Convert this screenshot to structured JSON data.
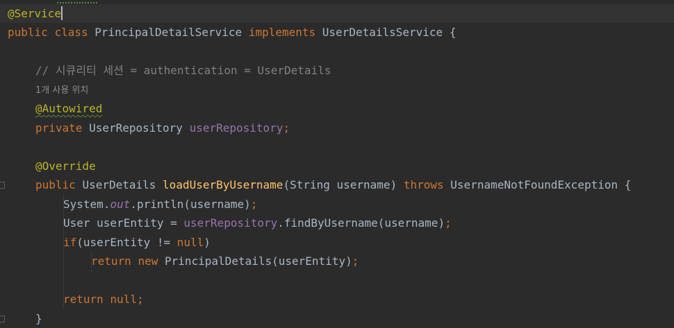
{
  "editor": {
    "lines": {
      "l1": {
        "annotation": "@Service"
      },
      "l2": {
        "kw_public": "public",
        "kw_class": "class",
        "class_name": "PrincipalDetailService",
        "kw_implements": "implements",
        "interface_name": "UserDetailsService",
        "brace": "{"
      },
      "l3": {
        "comment": "// 시큐리티 세션 = authentication = UserDetails"
      },
      "l4": {
        "usage_hint": "1개 사용 위치"
      },
      "l5": {
        "annotation": "@Autowired"
      },
      "l6": {
        "kw_private": "private",
        "type": "UserRepository",
        "field": "userRepository",
        "semicolon": ";"
      },
      "l7": {
        "annotation": "@Override"
      },
      "l8": {
        "kw_public": "public",
        "return_type": "UserDetails",
        "method": "loadUserByUsername",
        "params": "(String username)",
        "kw_throws": "throws",
        "exception": "UsernameNotFoundException",
        "brace": "{"
      },
      "l9": {
        "object": "System.",
        "static_field": "out",
        "call": ".println(username)",
        "semicolon": ";"
      },
      "l10": {
        "decl": "User userEntity = ",
        "field": "userRepository",
        "call": ".findByUsername(username)",
        "semicolon": ";"
      },
      "l11": {
        "kw_if": "if",
        "cond_open": "(userEntity != ",
        "kw_null": "null",
        "cond_close": ")"
      },
      "l12": {
        "kw_return": "return",
        "kw_new": "new",
        "ctor": "PrincipalDetails(userEntity)",
        "semicolon": ";"
      },
      "l13": {
        "kw_return": "return",
        "kw_null": "null",
        "semicolon": ";"
      },
      "l14": {
        "brace": "}"
      }
    },
    "colors": {
      "background": "#2b2b2b",
      "keyword": "#cc7832",
      "annotation": "#bbb529",
      "method": "#ffc66d",
      "field": "#9876aa",
      "comment": "#808080",
      "text": "#a9b7c6"
    }
  }
}
